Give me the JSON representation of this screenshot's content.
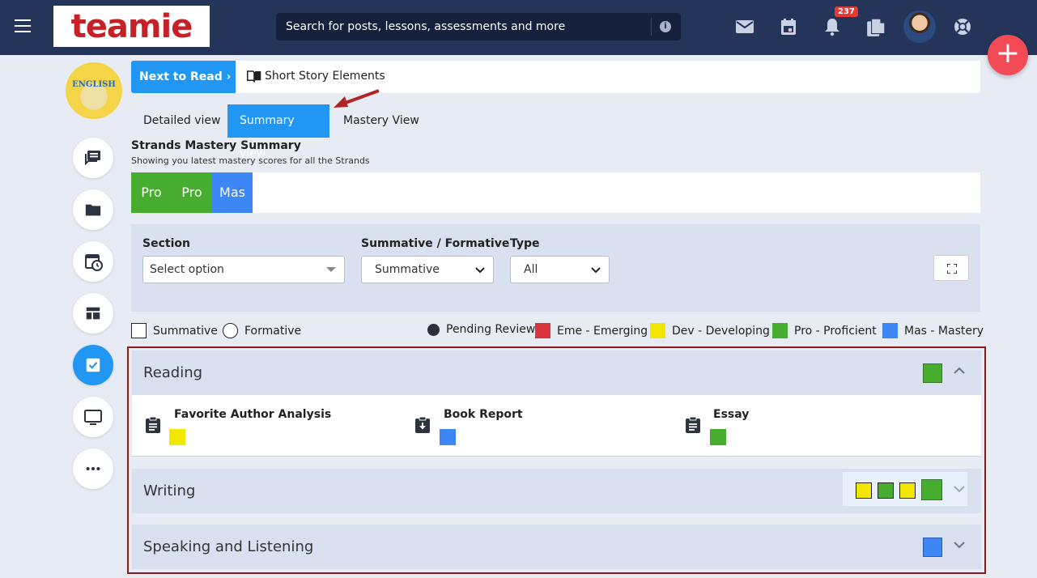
{
  "header": {
    "logo_text": "teamie",
    "search_placeholder": "Search for posts, lessons, assessments and more",
    "notification_count": "237",
    "icons": [
      "menu-icon",
      "info-icon",
      "mail-icon",
      "calendar-icon",
      "bell-icon",
      "documents-icon",
      "help-icon"
    ]
  },
  "course": {
    "badge_text": "ENGLISH"
  },
  "sidebar": {
    "items": [
      {
        "name": "posts",
        "icon": "chat-icon"
      },
      {
        "name": "files",
        "icon": "folder-icon"
      },
      {
        "name": "schedule",
        "icon": "calendar-clock-icon"
      },
      {
        "name": "dashboard",
        "icon": "dashboard-icon"
      },
      {
        "name": "assessments",
        "icon": "checkbox-icon",
        "active": true
      },
      {
        "name": "classroom",
        "icon": "monitor-icon"
      },
      {
        "name": "more",
        "icon": "more-icon"
      }
    ]
  },
  "next_to_read": {
    "button_label": "Next to Read",
    "chevron": "›",
    "link_label": "Short Story Elements"
  },
  "tabs": [
    {
      "label": "Detailed view",
      "active": false
    },
    {
      "label": "Summary view",
      "active": true
    },
    {
      "label": "Mastery View",
      "active": false
    }
  ],
  "summary": {
    "title": "Strands Mastery Summary",
    "subtitle": "Showing you latest mastery scores for all the Strands",
    "strand_scores": [
      {
        "label": "Pro",
        "color": "#46ad2f"
      },
      {
        "label": "Pro",
        "color": "#46ad2f"
      },
      {
        "label": "Mas",
        "color": "#3d86f5"
      }
    ]
  },
  "filters": {
    "section": {
      "label": "Section",
      "value": "Select option"
    },
    "type_mode": {
      "label": "Summative / Formative",
      "value": "Summative"
    },
    "type": {
      "label": "Type",
      "value": "All"
    }
  },
  "legend": {
    "summative": "Summative",
    "formative": "Formative",
    "pending": "Pending Review",
    "emerging": {
      "label": "Eme - Emerging",
      "color": "#d8323c"
    },
    "developing": {
      "label": "Dev - Developing",
      "color": "#f3e600"
    },
    "proficient": {
      "label": "Pro - Proficient",
      "color": "#46ad2f"
    },
    "mastery": {
      "label": "Mas - Mastery",
      "color": "#3d86f5"
    }
  },
  "strands": [
    {
      "name": "Reading",
      "expanded": true,
      "scores": [
        "#46ad2f"
      ],
      "assessments": [
        {
          "title": "Favorite Author Analysis",
          "icon": "clipboard-icon",
          "color": "#f3e600"
        },
        {
          "title": "Book Report",
          "icon": "clipboard-download-icon",
          "color": "#3d86f5"
        },
        {
          "title": "Essay",
          "icon": "clipboard-icon",
          "color": "#46ad2f"
        }
      ]
    },
    {
      "name": "Writing",
      "expanded": false,
      "scores": [
        "#f3e600",
        "#46ad2f",
        "#f3e600",
        "#46ad2f"
      ]
    },
    {
      "name": "Speaking and Listening",
      "expanded": false,
      "scores": [
        "#3d86f5"
      ]
    }
  ]
}
